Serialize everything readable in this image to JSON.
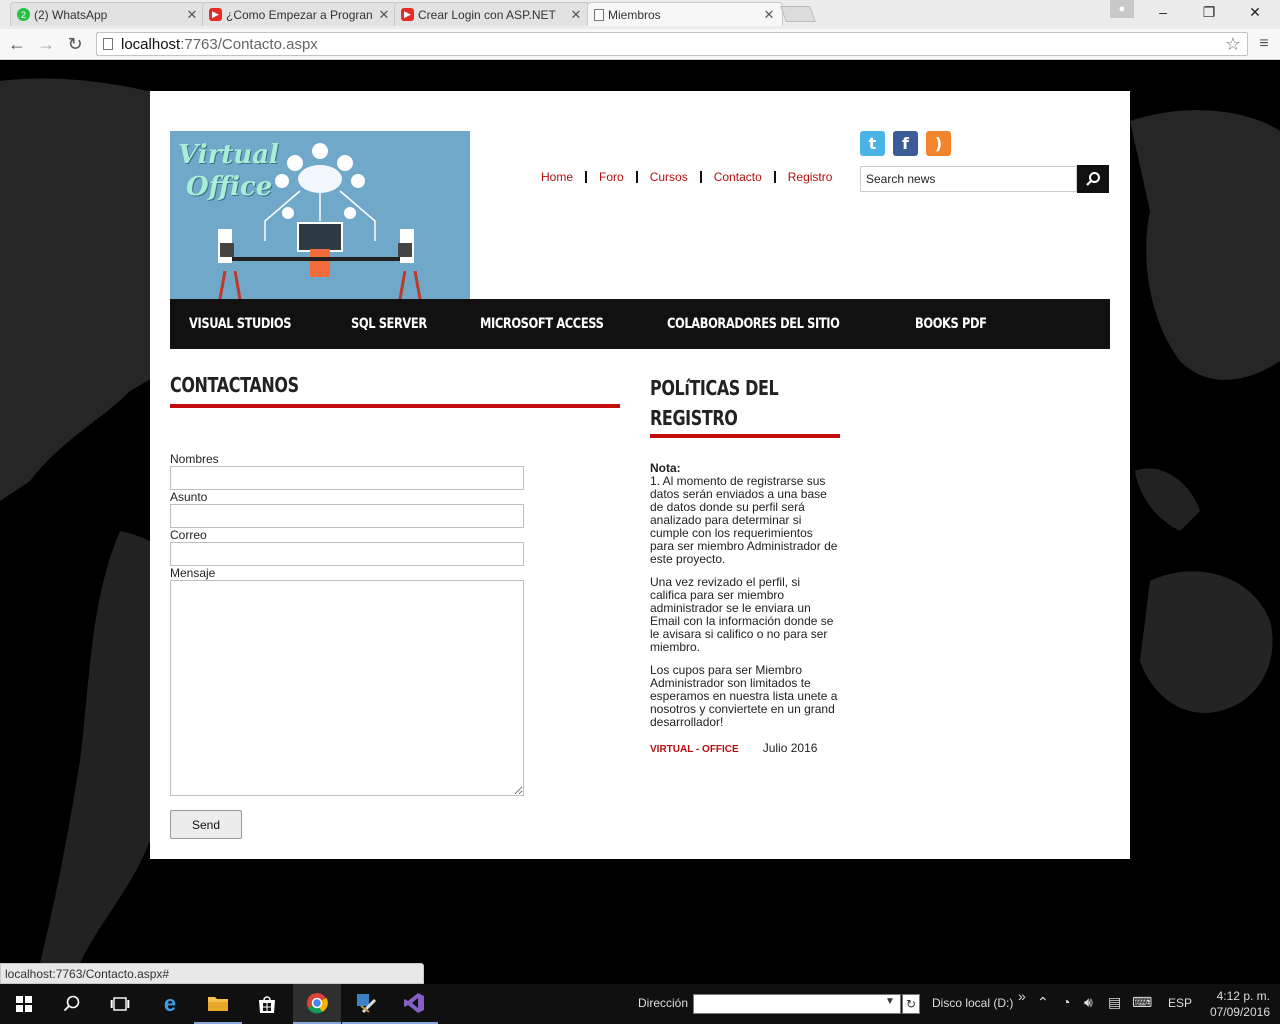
{
  "browser": {
    "tabs": [
      {
        "title": "(2) WhatsApp",
        "icon": "whatsapp-icon",
        "active": false
      },
      {
        "title": "¿Como Empezar a Progran",
        "icon": "youtube-icon",
        "active": false
      },
      {
        "title": "Crear Login con ASP.NET",
        "icon": "youtube-icon",
        "active": false
      },
      {
        "title": "Miembros",
        "icon": "page-icon",
        "active": true
      }
    ],
    "tab_close_glyph": "✕",
    "url_host": "localhost",
    "url_rest": ":7763/Contacto.aspx",
    "status_url": "localhost:7763/Contacto.aspx#"
  },
  "site": {
    "logo_text": [
      "Virtual",
      "Office"
    ],
    "top_nav": [
      "Home",
      "Foro",
      "Cursos",
      "Contacto",
      "Registro"
    ],
    "social": [
      {
        "name": "twitter-icon",
        "glyph": "t"
      },
      {
        "name": "facebook-icon",
        "glyph": "f"
      },
      {
        "name": "rss-icon",
        "glyph": ")"
      }
    ],
    "search_placeholder": "Search news",
    "main_nav": [
      "VISUAL STUDIOS",
      "SQL SERVER",
      "MICROSOFT ACCESS",
      "COLABORADORES DEL SITIO",
      "BOOKS PDF"
    ],
    "contact_title": "CONTACTANOS",
    "form": {
      "nombres_label": "Nombres",
      "asunto_label": "Asunto",
      "correo_label": "Correo",
      "mensaje_label": "Mensaje",
      "send_label": "Send"
    },
    "policy_title": "POLíTICAS DEL REGISTRO",
    "policy": {
      "nota_label": "Nota:",
      "p1": "1. Al momento de registrarse sus datos serán enviados a una base de datos donde su perfil será analizado para determinar si cumple con los requerimientos para ser miembro Administrador de este proyecto.",
      "p2": "Una vez revizado el perfil, si califica para ser miembro administrador se le enviara un Email con la información donde se le avisara si califico o no para ser miembro.",
      "p3": "Los cupos para ser Miembro Administrador son limitados te esperamos en nuestra lista unete a nosotros y conviertete en un grand desarrollador!",
      "brand": "VIRTUAL - OFFICE",
      "date": "Julio 2016"
    },
    "accent_color": "#c40d0d"
  },
  "taskbar": {
    "address_label": "Dirección",
    "disk_label": "Disco local (D:)",
    "overflow_glyph": "»",
    "lang": "ESP",
    "time": "4:12 p. m.",
    "date": "07/09/2016"
  }
}
